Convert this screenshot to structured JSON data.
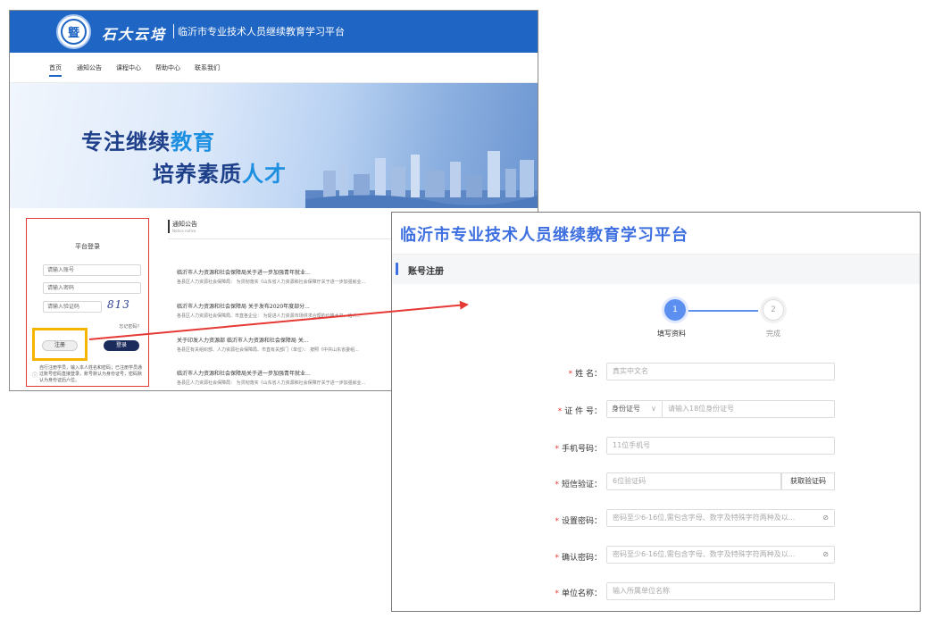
{
  "colors": {
    "brand_blue": "#1f65c4",
    "accent_blue": "#3d6fe0",
    "highlight_red": "#e53935",
    "highlight_yellow": "#f5b400"
  },
  "portal": {
    "logo_char": "曁",
    "brand": "石大云培",
    "site_name": "临沂市专业技术人员继续教育学习平台",
    "nav": [
      "首页",
      "通知公告",
      "课程中心",
      "帮助中心",
      "联系我们"
    ],
    "banner": {
      "slogan1_main": "专注继续",
      "slogan1_hl": "教育",
      "slogan2_main": "培养素质",
      "slogan2_hl": "人才"
    },
    "login": {
      "title": "平台登录",
      "account_placeholder": "请输入账号",
      "password_placeholder": "请输入密码",
      "captcha_placeholder": "请输入验证码",
      "captcha_value": "813",
      "forgot": "忘记密码?",
      "register_button": "注册",
      "login_button": "登录",
      "note": "自行注册学员，输入本人姓名和密码；已注册学员通过账号密码直接登录，账号默认为身份证号，密码默认为身份证后六位。",
      "note_icon": "info-icon"
    },
    "notice": {
      "title": "通知公告",
      "subtitle": "Notice notice",
      "items": [
        {
          "title": "临沂市人力资源和社会保障局关于进一步加强青年就业...",
          "meta": "各县区人力资源社会保障局：   为贯彻落实《山东省人力资源和社会保障厅关于进一步加强就业..."
        },
        {
          "title": "临沂市人力资源和社会保障局 关于发布2020年度部分...",
          "meta": "各县区人力资源社会保障局、市直各企业：   为促进人力资源市场供求合理的价格水平，给人..."
        },
        {
          "title": "关于印发人力资源部 临沂市人力资源和社会保障局 关...",
          "meta": "各县区有关组织部、人力资源社会保障局、市直有关部门（单位）：   按照《中共山东省委组..."
        },
        {
          "title": "临沂市人力资源和社会保障局关于进一步加强青年就业...",
          "meta": "各县区人力资源社会保障局：   为贯彻落实《山东省人力资源和社会保障厅关于进一步加强就业..."
        }
      ]
    }
  },
  "register": {
    "site_title": "临沂市专业技术人员继续教育学习平台",
    "section_title": "账号注册",
    "steps": [
      {
        "num": "1",
        "label": "填写资料"
      },
      {
        "num": "2",
        "label": "完成"
      }
    ],
    "fields": {
      "name": {
        "label": "姓 名：",
        "placeholder": "真实中文名"
      },
      "id": {
        "label": "证 件 号：",
        "type_value": "身份证号",
        "placeholder": "请输入18位身份证号"
      },
      "phone": {
        "label": "手机号码：",
        "placeholder": "11位手机号"
      },
      "sms": {
        "label": "短信验证：",
        "placeholder": "6位验证码",
        "button": "获取验证码"
      },
      "password": {
        "label": "设置密码：",
        "placeholder": "密码至少6-16位,需包含字母、数字及特殊字符两种及以..."
      },
      "confirm": {
        "label": "确认密码：",
        "placeholder": "密码至少6-16位,需包含字母、数字及特殊字符两种及以..."
      },
      "unit": {
        "label": "单位名称：",
        "placeholder": "输入所属单位名称"
      }
    }
  }
}
